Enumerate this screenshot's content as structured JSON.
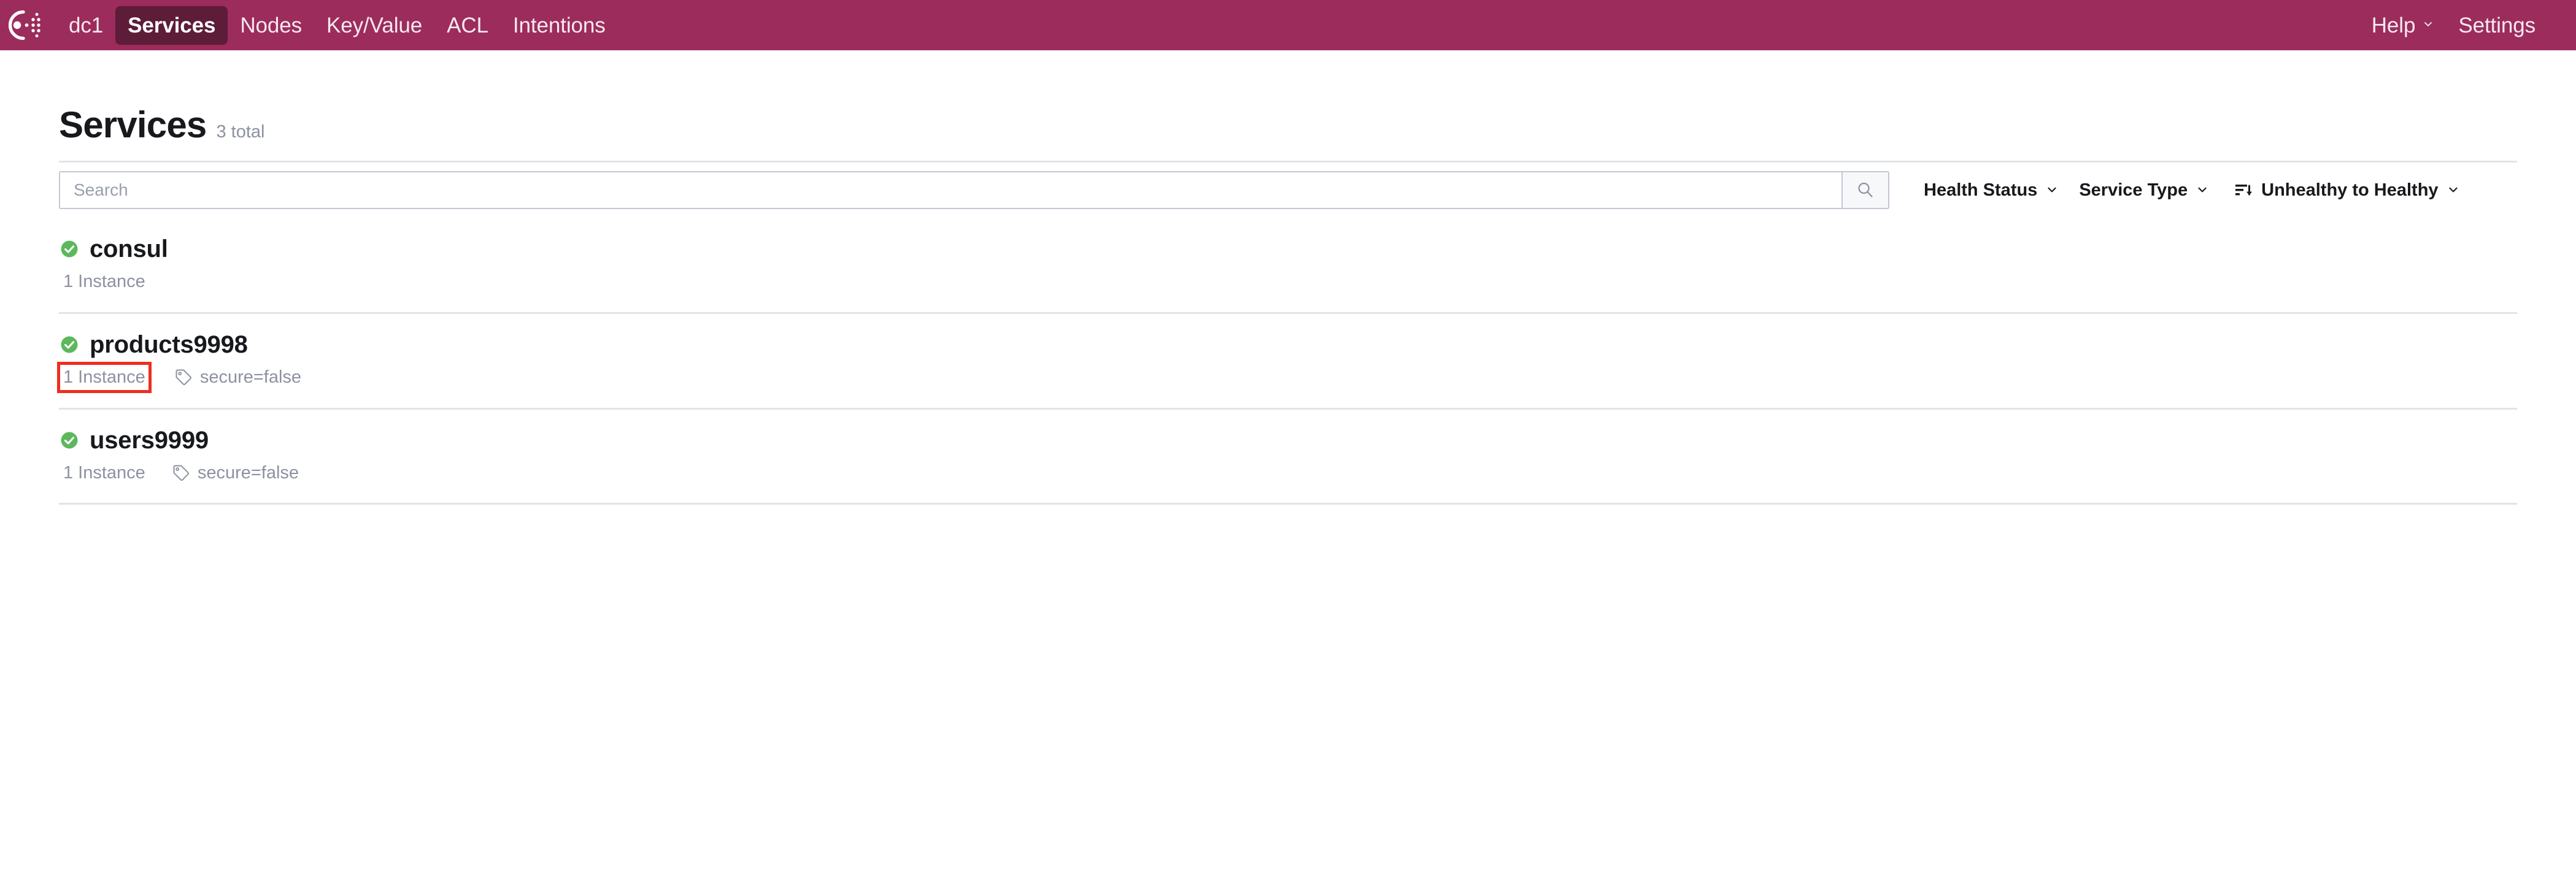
{
  "theme": {
    "navbar_bg": "#9c2c5c",
    "navbar_active_bg": "#5d1c38",
    "page_bg": "#ffffff",
    "text_primary": "#17191d",
    "text_muted": "#8c92a0",
    "divider": "#e1e3e8",
    "health_passing": "#5cb85c",
    "annotation": "#ef2d20"
  },
  "navbar": {
    "logo_name": "consul-logo",
    "items": [
      {
        "label": "dc1",
        "name": "nav-item-dc1",
        "active": false
      },
      {
        "label": "Services",
        "name": "nav-item-services",
        "active": true
      },
      {
        "label": "Nodes",
        "name": "nav-item-nodes",
        "active": false
      },
      {
        "label": "Key/Value",
        "name": "nav-item-key-value",
        "active": false
      },
      {
        "label": "ACL",
        "name": "nav-item-acl",
        "active": false
      },
      {
        "label": "Intentions",
        "name": "nav-item-intentions",
        "active": false
      }
    ],
    "help_label": "Help",
    "settings_label": "Settings"
  },
  "page": {
    "title": "Services",
    "total": "3 total"
  },
  "search": {
    "placeholder": "Search",
    "value": "",
    "button_icon": "search-icon"
  },
  "filters": {
    "health_status": "Health Status",
    "service_type": "Service Type",
    "sort_icon": "sort-descending-icon",
    "sort_value": "Unhealthy to Healthy"
  },
  "services": [
    {
      "name": "consul",
      "health": "passing",
      "instances": "1 Instance",
      "tags": [],
      "highlighted": false
    },
    {
      "name": "products9998",
      "health": "passing",
      "instances": "1 Instance",
      "tags": [
        "secure=false"
      ],
      "highlighted": true
    },
    {
      "name": "users9999",
      "health": "passing",
      "instances": "1 Instance",
      "tags": [
        "secure=false"
      ],
      "highlighted": false
    }
  ]
}
